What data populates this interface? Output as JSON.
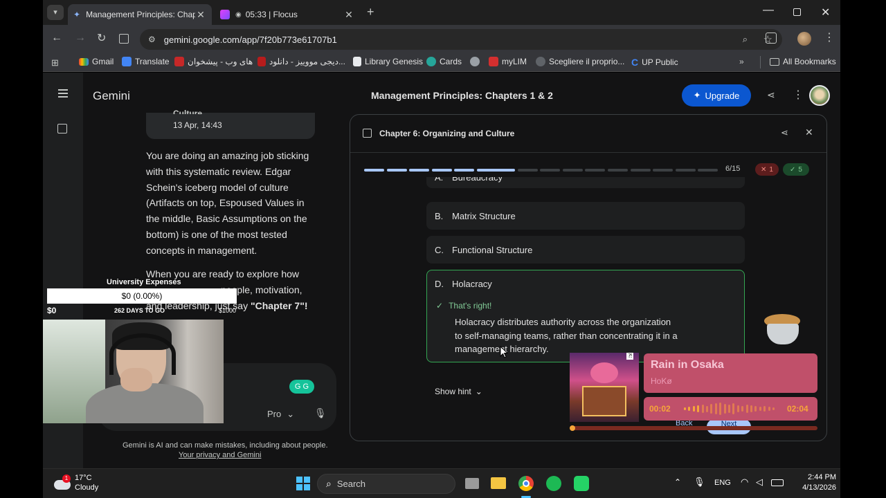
{
  "browser": {
    "tabs": [
      {
        "title": "Management Principles: Chapte",
        "active": true
      },
      {
        "title": "05:33 | Flocus",
        "active": false
      }
    ],
    "url": "gemini.google.com/app/7f20b773e61707b1",
    "bookmarks": [
      "Gmail",
      "Translate",
      "های وب - پیشخوان",
      "دیجی مووییز - دانلود...",
      "Library Genesis",
      "Cards",
      "myLIM",
      "Scegliere il proprio...",
      "UP Public"
    ],
    "all_bookmarks": "All Bookmarks"
  },
  "gemini": {
    "brand": "Gemini",
    "conversation_title": "Management Principles: Chapters 1 & 2",
    "upgrade_label": "Upgrade",
    "chat": {
      "card_title": "Culture",
      "card_date": "13 Apr, 14:43",
      "paragraph1": "You are doing an amazing job sticking with this systematic review. Edgar Schein's iceberg model of culture (Artifacts on top, Espoused Values in the middle, Basic Assumptions on the bottom) is one of the most tested concepts in management.",
      "paragraph2_start": "When you are ready to explore how",
      "paragraph2_mid": "people, motivation,",
      "paragraph2_end": "and leadership, just say",
      "paragraph2_bold": "\"Chapter 7\"!",
      "model_label": "Pro",
      "disclaimer": "Gemini is AI and can make mistakes, including about people.",
      "privacy_link": "Your privacy and Gemini"
    },
    "quiz": {
      "title": "Chapter 6: Organizing and Culture",
      "progress_text": "6/15",
      "progress_fraction": 0.4,
      "wrong_count": "1",
      "right_count": "5",
      "options": [
        {
          "letter": "A.",
          "text": "Bureaucracy"
        },
        {
          "letter": "B.",
          "text": "Matrix Structure"
        },
        {
          "letter": "C.",
          "text": "Functional Structure"
        },
        {
          "letter": "D.",
          "text": "Holacracy"
        }
      ],
      "feedback_title": "That's right!",
      "feedback_line1": "Holacracy distributes authority across the organization",
      "feedback_line2": "to self-managing teams, rather than concentrating it in a",
      "feedback_line3": "management hierarchy.",
      "show_hint": "Show hint",
      "back_label": "Back",
      "next_label": "Next"
    }
  },
  "overlays": {
    "expenses_title": "University Expenses",
    "expenses_value": "$0 (0.00%)",
    "expenses_min": "$0",
    "expenses_days": "262 DAYS TO GO",
    "expenses_max": "$1000",
    "expenses_progress": 0,
    "music_title": "Rain in Osaka",
    "music_artist": "HoKø",
    "music_elapsed": "00:02",
    "music_total": "02:04"
  },
  "taskbar": {
    "temperature": "17°C",
    "weather": "Cloudy",
    "weather_badge": "1",
    "search_placeholder": "Search",
    "language": "ENG",
    "time": "2:44 PM",
    "date": "4/13/2026"
  },
  "colors": {
    "accent_blue": "#a8c7fa",
    "correct_green": "#34a853",
    "wrong_red": "#f28b82",
    "upgrade_bg": "#0b57d0"
  }
}
